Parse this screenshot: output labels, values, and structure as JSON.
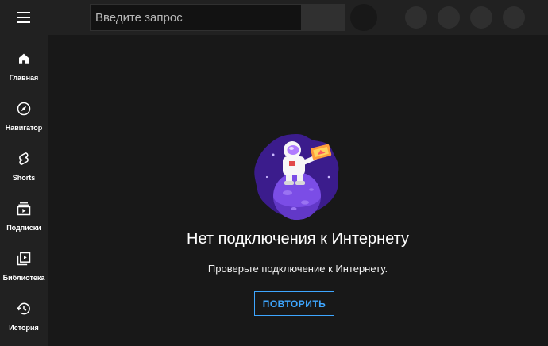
{
  "header": {
    "search_placeholder": "Введите запрос"
  },
  "sidebar": {
    "items": [
      {
        "label": "Главная",
        "icon": "home-icon"
      },
      {
        "label": "Навигатор",
        "icon": "compass-icon"
      },
      {
        "label": "Shorts",
        "icon": "shorts-icon"
      },
      {
        "label": "Подписки",
        "icon": "subscriptions-icon"
      },
      {
        "label": "Библиотека",
        "icon": "library-icon"
      },
      {
        "label": "История",
        "icon": "history-icon"
      }
    ]
  },
  "main": {
    "title": "Нет подключения к Интернету",
    "subtitle": "Проверьте подключение к Интернету.",
    "retry_label": "ПОВТОРИТЬ",
    "illustration": "astronaut-on-planet-illustration"
  },
  "colors": {
    "accent": "#3ea6ff",
    "background": "#181818",
    "bar": "#212121"
  }
}
